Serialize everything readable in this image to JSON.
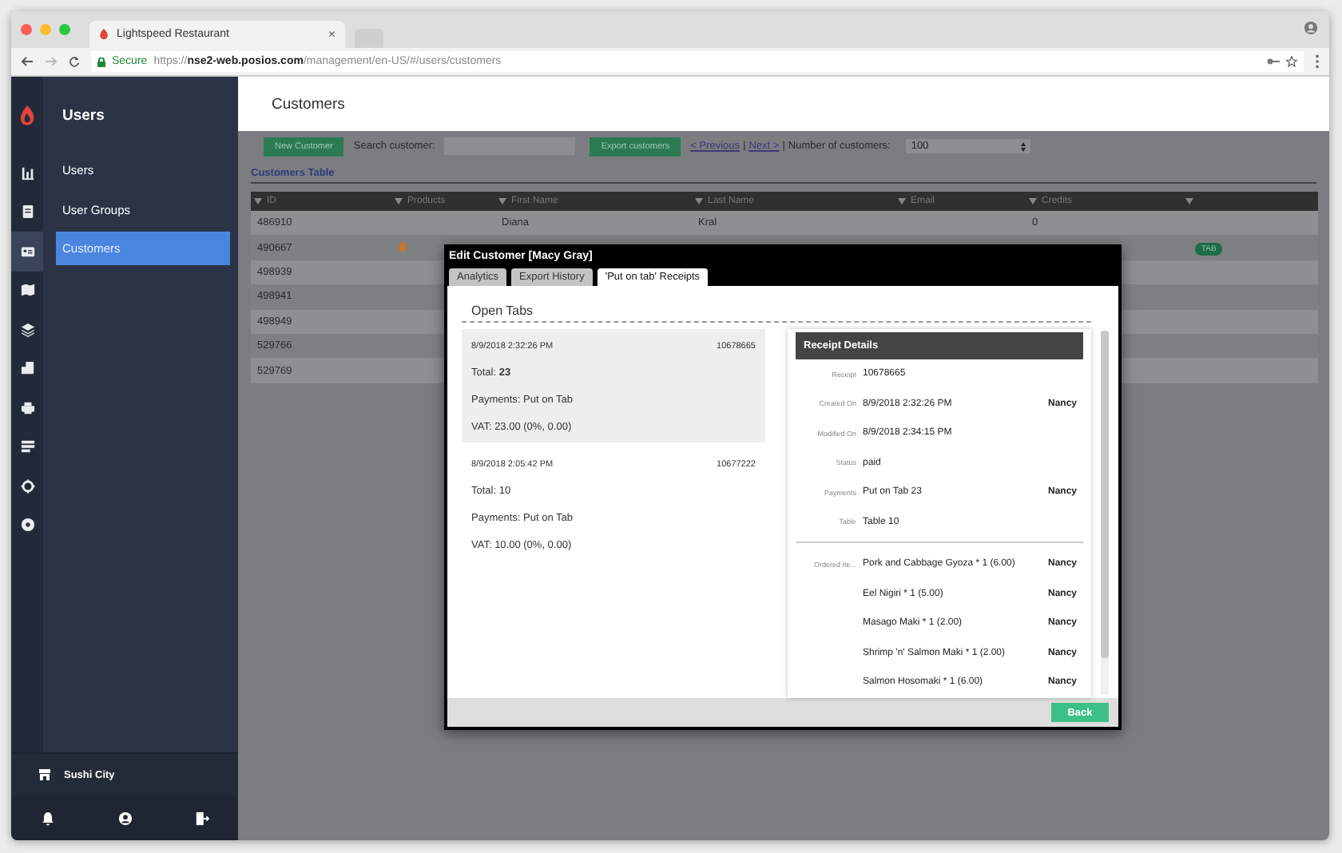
{
  "browser": {
    "tab_title": "Lightspeed Restaurant",
    "close": "×",
    "secure_label": "Secure",
    "url": "https://**nse2-web.posios.com**/management/en-US/#/users/customers"
  },
  "rail": {
    "icons": [
      {
        "kind": "chart",
        "selected": false
      },
      {
        "kind": "document",
        "selected": false
      },
      {
        "kind": "card",
        "selected": true
      },
      {
        "kind": "map",
        "selected": false
      },
      {
        "kind": "layers",
        "selected": false
      },
      {
        "kind": "devices",
        "selected": false
      },
      {
        "kind": "printer",
        "selected": false
      },
      {
        "kind": "stack",
        "selected": false
      },
      {
        "kind": "gear",
        "selected": false
      },
      {
        "kind": "help",
        "selected": false
      }
    ]
  },
  "sidebar": {
    "title": "Users",
    "items": [
      {
        "label": "Users",
        "selected": false
      },
      {
        "label": "User Groups",
        "selected": false
      },
      {
        "label": "Customers",
        "selected": true
      }
    ],
    "store": "Sushi City"
  },
  "page": {
    "title": "Customers"
  },
  "toolbar": {
    "new_button": "New Customer",
    "search_label": "Search customer:",
    "export_button": "Export customers",
    "previous_link": "< Previous",
    "separator_1": "|",
    "next_link": "Next >",
    "separator_2": "|",
    "count_label": "Number of customers:",
    "count_value": "100"
  },
  "table": {
    "title": "Customers Table",
    "columns": [
      "ID",
      "Products",
      "First Name",
      "Last Name",
      "Email",
      "Credits"
    ],
    "rows": [
      {
        "id": "486910",
        "products": false,
        "first_name": "Diana",
        "last_name": "Kral",
        "credits": "0"
      },
      {
        "id": "490667",
        "products": true,
        "badge": "TAB"
      },
      {
        "id": "498939",
        "products": false
      },
      {
        "id": "498941",
        "products": false
      },
      {
        "id": "498949",
        "products": false
      },
      {
        "id": "529766",
        "products": false
      },
      {
        "id": "529769",
        "products": false
      }
    ]
  },
  "modal": {
    "title": "Edit Customer [Macy Gray]",
    "tabs": [
      {
        "label": "Analytics",
        "selected": false
      },
      {
        "label": "Export History",
        "selected": false
      },
      {
        "label": "'Put on tab' Receipts",
        "selected": true
      }
    ],
    "section_title": "Open Tabs",
    "open_tabs": [
      {
        "date": "8/9/2018 2:32:26 PM",
        "number": "10678665",
        "total": "Total: **23**",
        "payments": "Payments: Put on Tab",
        "vat": "VAT: 23.00 (0%, 0.00)",
        "selected": true
      },
      {
        "date": "8/9/2018 2:05:42 PM",
        "number": "10677222",
        "total": "Total: 10",
        "payments": "Payments: Put on Tab",
        "vat": "VAT: 10.00 (0%, 0.00)",
        "selected": false
      }
    ],
    "receipt": {
      "title": "Receipt Details",
      "fields": [
        {
          "label": "Receipt",
          "value": "10678665"
        },
        {
          "label": "Created On",
          "value": "8/9/2018 2:32:26 PM",
          "user": "Nancy"
        },
        {
          "label": "Modified On",
          "value": "8/9/2018 2:34:15 PM"
        },
        {
          "label": "Status",
          "value": "paid"
        },
        {
          "label": "Payments",
          "value": "Put on Tab 23",
          "user": "Nancy"
        },
        {
          "label": "Table",
          "value": "Table 10"
        }
      ],
      "items_label": "Ordered Ite...",
      "items": [
        {
          "name": "Pork and Cabbage Gyoza * 1 (6.00)",
          "user": "Nancy"
        },
        {
          "name": "Eel Nigiri * 1 (5.00)",
          "user": "Nancy"
        },
        {
          "name": "Masago Maki * 1 (2.00)",
          "user": "Nancy"
        },
        {
          "name": "Shrimp 'n' Salmon Maki * 1 (2.00)",
          "user": "Nancy"
        },
        {
          "name": "Salmon Hosomaki * 1 (6.00)",
          "user": "Nancy"
        }
      ]
    },
    "back_button": "Back"
  }
}
